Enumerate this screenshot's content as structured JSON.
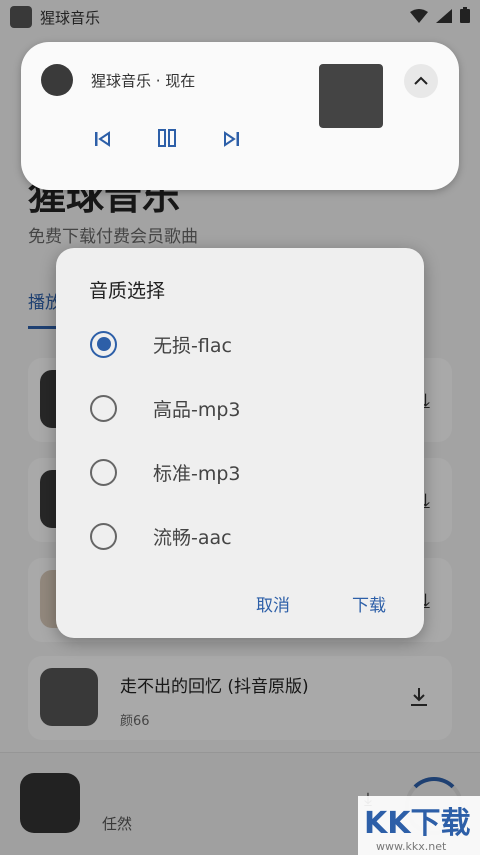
{
  "status_bar": {
    "title": "猩球音乐"
  },
  "app": {
    "title": "猩球音乐",
    "subtitle": "免费下载付费会员歌曲",
    "tab_play": "播放"
  },
  "songs": [
    {
      "title": "走不出的回忆 (抖音原版)",
      "artist": "颜66"
    }
  ],
  "player": {
    "artist": "任然"
  },
  "notification": {
    "title": "猩球音乐 · 现在"
  },
  "dialog": {
    "title": "音质选择",
    "options": [
      "无损-flac",
      "高品-mp3",
      "标准-mp3",
      "流畅-aac"
    ],
    "selected_option": "无损-flac",
    "cancel": "取消",
    "download": "下载"
  },
  "colors": {
    "accent": "#2d5fa8"
  },
  "icons": [
    "wifi-icon",
    "signal-icon",
    "battery-icon",
    "chevron-up-icon",
    "skip-previous-icon",
    "pause-icon",
    "skip-next-icon",
    "download-icon"
  ]
}
